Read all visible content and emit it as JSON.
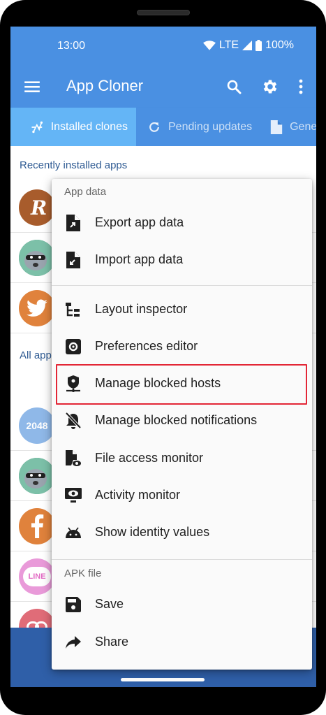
{
  "status_bar": {
    "time": "13:00",
    "network": "LTE",
    "battery": "100%"
  },
  "app_bar": {
    "title": "App Cloner",
    "icons": [
      "menu-icon",
      "search-icon",
      "gear-icon",
      "more-vert-icon"
    ]
  },
  "tabs": [
    {
      "label": "Installed clones",
      "icon": "clone-icon",
      "active": true
    },
    {
      "label": "Pending updates",
      "icon": "refresh-icon",
      "active": false
    },
    {
      "label": "Gene",
      "icon": "file-icon",
      "active": false
    }
  ],
  "lists": {
    "recent_header": "Recently installed apps",
    "all_header": "All app",
    "icon_2048": "2048",
    "icon_line": "LINE"
  },
  "menu": {
    "section_app_data": "App data",
    "section_apk_file": "APK file",
    "items": [
      {
        "label": "Export app data",
        "icon": "export-file-icon"
      },
      {
        "label": "Import app data",
        "icon": "import-file-icon"
      },
      {
        "label": "Layout inspector",
        "icon": "layout-tree-icon"
      },
      {
        "label": "Preferences editor",
        "icon": "preferences-gear-icon"
      },
      {
        "label": "Manage blocked hosts",
        "icon": "shield-network-icon",
        "highlighted": true
      },
      {
        "label": "Manage blocked notifications",
        "icon": "bell-off-icon"
      },
      {
        "label": "File access monitor",
        "icon": "file-eye-icon"
      },
      {
        "label": "Activity monitor",
        "icon": "monitor-eye-icon"
      },
      {
        "label": "Show identity values",
        "icon": "android-icon"
      },
      {
        "label": "Save",
        "icon": "save-icon"
      },
      {
        "label": "Share",
        "icon": "share-icon"
      }
    ]
  },
  "colors": {
    "primary": "#4a90e2",
    "tab_active": "#64b5f6",
    "highlight": "#e32636",
    "section_text": "#2f5b93"
  }
}
